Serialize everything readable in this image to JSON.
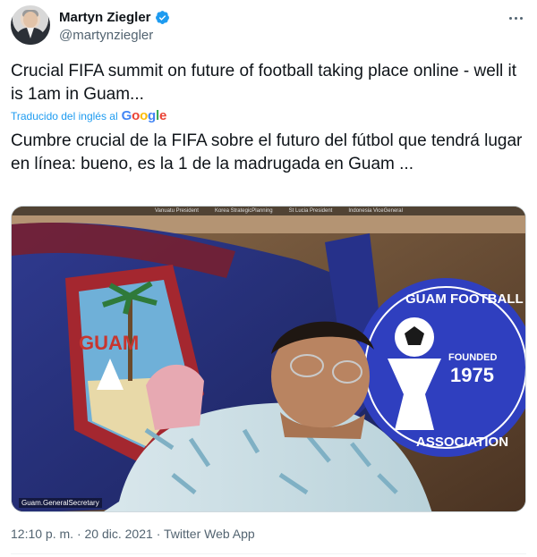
{
  "tweet": {
    "author": {
      "display_name": "Martyn Ziegler",
      "handle": "@martynziegler",
      "verified": true
    },
    "text": "Crucial FIFA summit on future of football taking place online - well it is 1am in Guam...",
    "translation": {
      "label": "Traducido del inglés al",
      "provider": "Google",
      "text": "Cumbre crucial de la FIFA sobre el futuro del fútbol que tendrá lugar en línea: bueno, es la 1 de la madrugada en Guam ..."
    },
    "media": {
      "participant_labels": [
        "Vanuatu President",
        "Korea StrategicPlanning",
        "St Lucia President",
        "Indonesia ViceGeneral"
      ],
      "caption": "Guam.GeneralSecretary",
      "flag_text": "GUAM",
      "badge": {
        "top_text": "GUAM FOOTBALL",
        "bottom_text": "ASSOCIATION",
        "founded_label": "FOUNDED",
        "founded_year": "1975"
      }
    },
    "timestamp": {
      "time": "12:10 p. m.",
      "separator": "·",
      "date": "20 dic. 2021",
      "source": "Twitter Web App"
    }
  },
  "colors": {
    "accent": "#1d9bf0",
    "text_primary": "#0f1419",
    "text_secondary": "#536471",
    "badge_blue": "#2f3fbf"
  },
  "icons": {
    "verified": "verified-badge-icon",
    "more": "more-options-icon"
  }
}
